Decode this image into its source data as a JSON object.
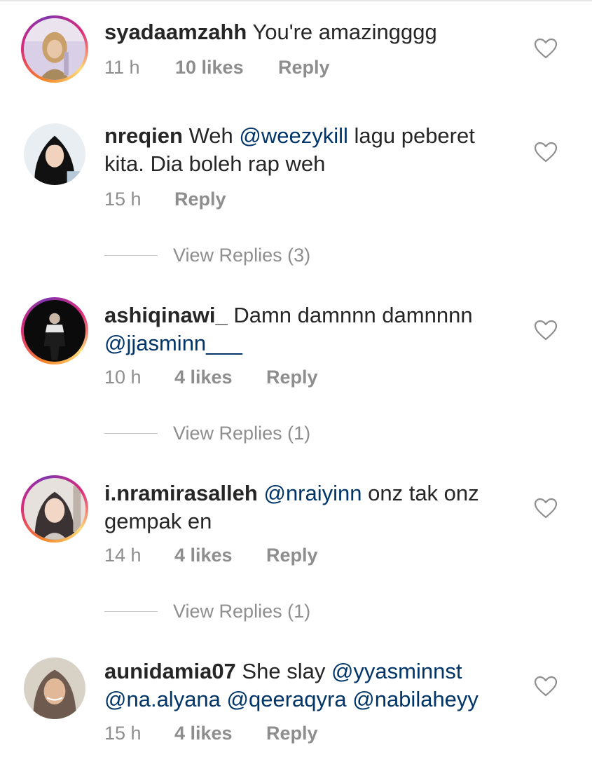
{
  "comments": [
    {
      "username": "syadaamzahh",
      "body": [
        {
          "text": " You're amazingggg",
          "mention": false
        }
      ],
      "time": "11 h",
      "likes": "10 likes",
      "reply_label": "Reply",
      "has_story": true
    },
    {
      "username": "nreqien",
      "body": [
        {
          "text": " Weh ",
          "mention": false
        },
        {
          "text": "@weezykill",
          "mention": true
        },
        {
          "text": " lagu peberet kita. Dia boleh rap weh",
          "mention": false
        }
      ],
      "time": "15 h",
      "likes": "",
      "reply_label": "Reply",
      "view_replies": "View Replies (3)",
      "has_story": false
    },
    {
      "username": "ashiqinawi_",
      "body": [
        {
          "text": " Damn damnnn damnnnn ",
          "mention": false
        },
        {
          "text": "@jjasminn___",
          "mention": true
        }
      ],
      "time": "10 h",
      "likes": "4 likes",
      "reply_label": "Reply",
      "view_replies": "View Replies (1)",
      "has_story": true
    },
    {
      "username": "i.nramirasalleh",
      "body": [
        {
          "text": " ",
          "mention": false
        },
        {
          "text": "@nraiyinn",
          "mention": true
        },
        {
          "text": " onz tak onz gempak en",
          "mention": false
        }
      ],
      "time": "14 h",
      "likes": "4 likes",
      "reply_label": "Reply",
      "view_replies": "View Replies (1)",
      "has_story": true
    },
    {
      "username": "aunidamia07",
      "body": [
        {
          "text": " She slay ",
          "mention": false
        },
        {
          "text": "@yyasminnst",
          "mention": true
        },
        {
          "text": " ",
          "mention": false
        },
        {
          "text": "@na.alyana",
          "mention": true
        },
        {
          "text": " ",
          "mention": false
        },
        {
          "text": "@qeeraqyra",
          "mention": true
        },
        {
          "text": " ",
          "mention": false
        },
        {
          "text": "@nabilaheyy",
          "mention": true
        }
      ],
      "time": "15 h",
      "likes": "4 likes",
      "reply_label": "Reply",
      "has_story": false
    }
  ],
  "icons": {
    "like": "heart-outline-icon"
  },
  "colors": {
    "text": "#262626",
    "meta": "#8e8e8e",
    "mention": "#003569",
    "divider": "#c7c7c7"
  }
}
